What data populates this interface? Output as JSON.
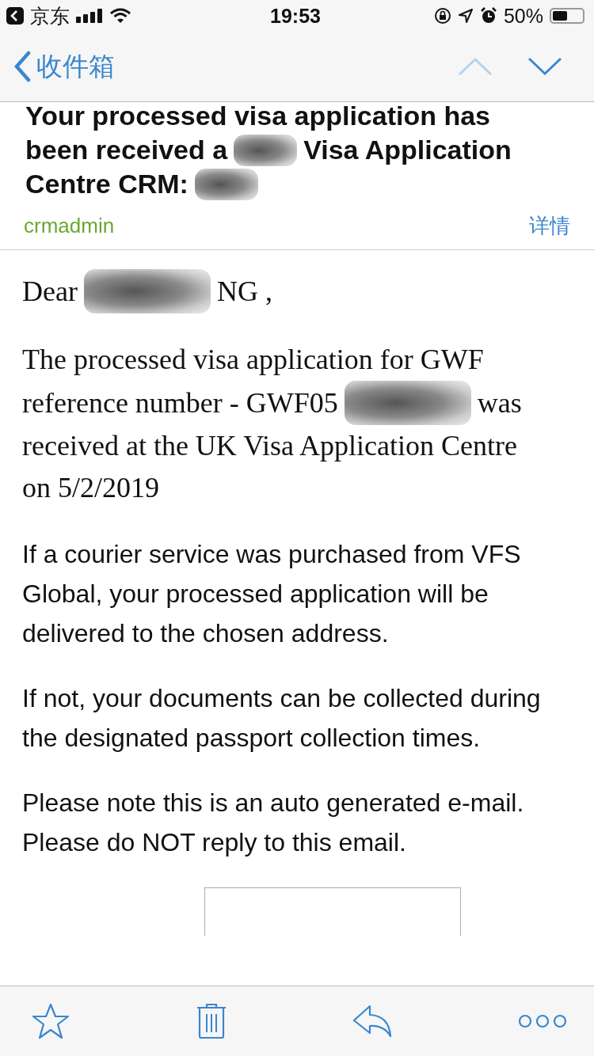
{
  "status_bar": {
    "back_app": "京东",
    "time": "19:53",
    "battery": "50%"
  },
  "nav": {
    "back_label": "收件箱",
    "previous_disabled": true,
    "next_disabled": false
  },
  "subject": [
    [
      {
        "kind": "text",
        "text": "Your processed visa application has"
      }
    ],
    [
      {
        "kind": "text",
        "text": "been received a"
      },
      {
        "kind": "redaction"
      },
      {
        "kind": "text",
        "text": "Visa Application"
      }
    ],
    [
      {
        "kind": "text",
        "text": "Centre CRM:"
      },
      {
        "kind": "redaction"
      }
    ]
  ],
  "sender": "crmadmin",
  "details_link": "详情",
  "body": [
    {
      "kind": "serif",
      "lines": [
        [
          {
            "kind": "text",
            "text": "Dear"
          },
          {
            "kind": "redaction"
          },
          {
            "kind": "text",
            "text": "NG ,"
          }
        ]
      ]
    },
    {
      "kind": "serif",
      "lines": [
        [
          {
            "kind": "text",
            "text": "The processed visa application for GWF"
          }
        ],
        [
          {
            "kind": "text",
            "text": "reference number -  GWF05"
          },
          {
            "kind": "redaction"
          },
          {
            "kind": "text",
            "text": "was"
          }
        ],
        [
          {
            "kind": "text",
            "text": "received at the UK Visa Application Centre"
          }
        ],
        [
          {
            "kind": "text",
            "text": "on  5/2/2019"
          }
        ]
      ]
    },
    {
      "kind": "sans",
      "text": "If a courier service was purchased from VFS Global, your processed application will be delivered to the chosen address."
    },
    {
      "kind": "sans",
      "text": "If not, your documents can be collected during the designated passport collection times."
    },
    {
      "kind": "sans",
      "text": "Please note this is an auto generated e-mail. Please do NOT reply to this email."
    }
  ],
  "toolbar": [
    {
      "kind": "star"
    },
    {
      "kind": "trash"
    },
    {
      "kind": "reply"
    },
    {
      "kind": "more"
    }
  ]
}
